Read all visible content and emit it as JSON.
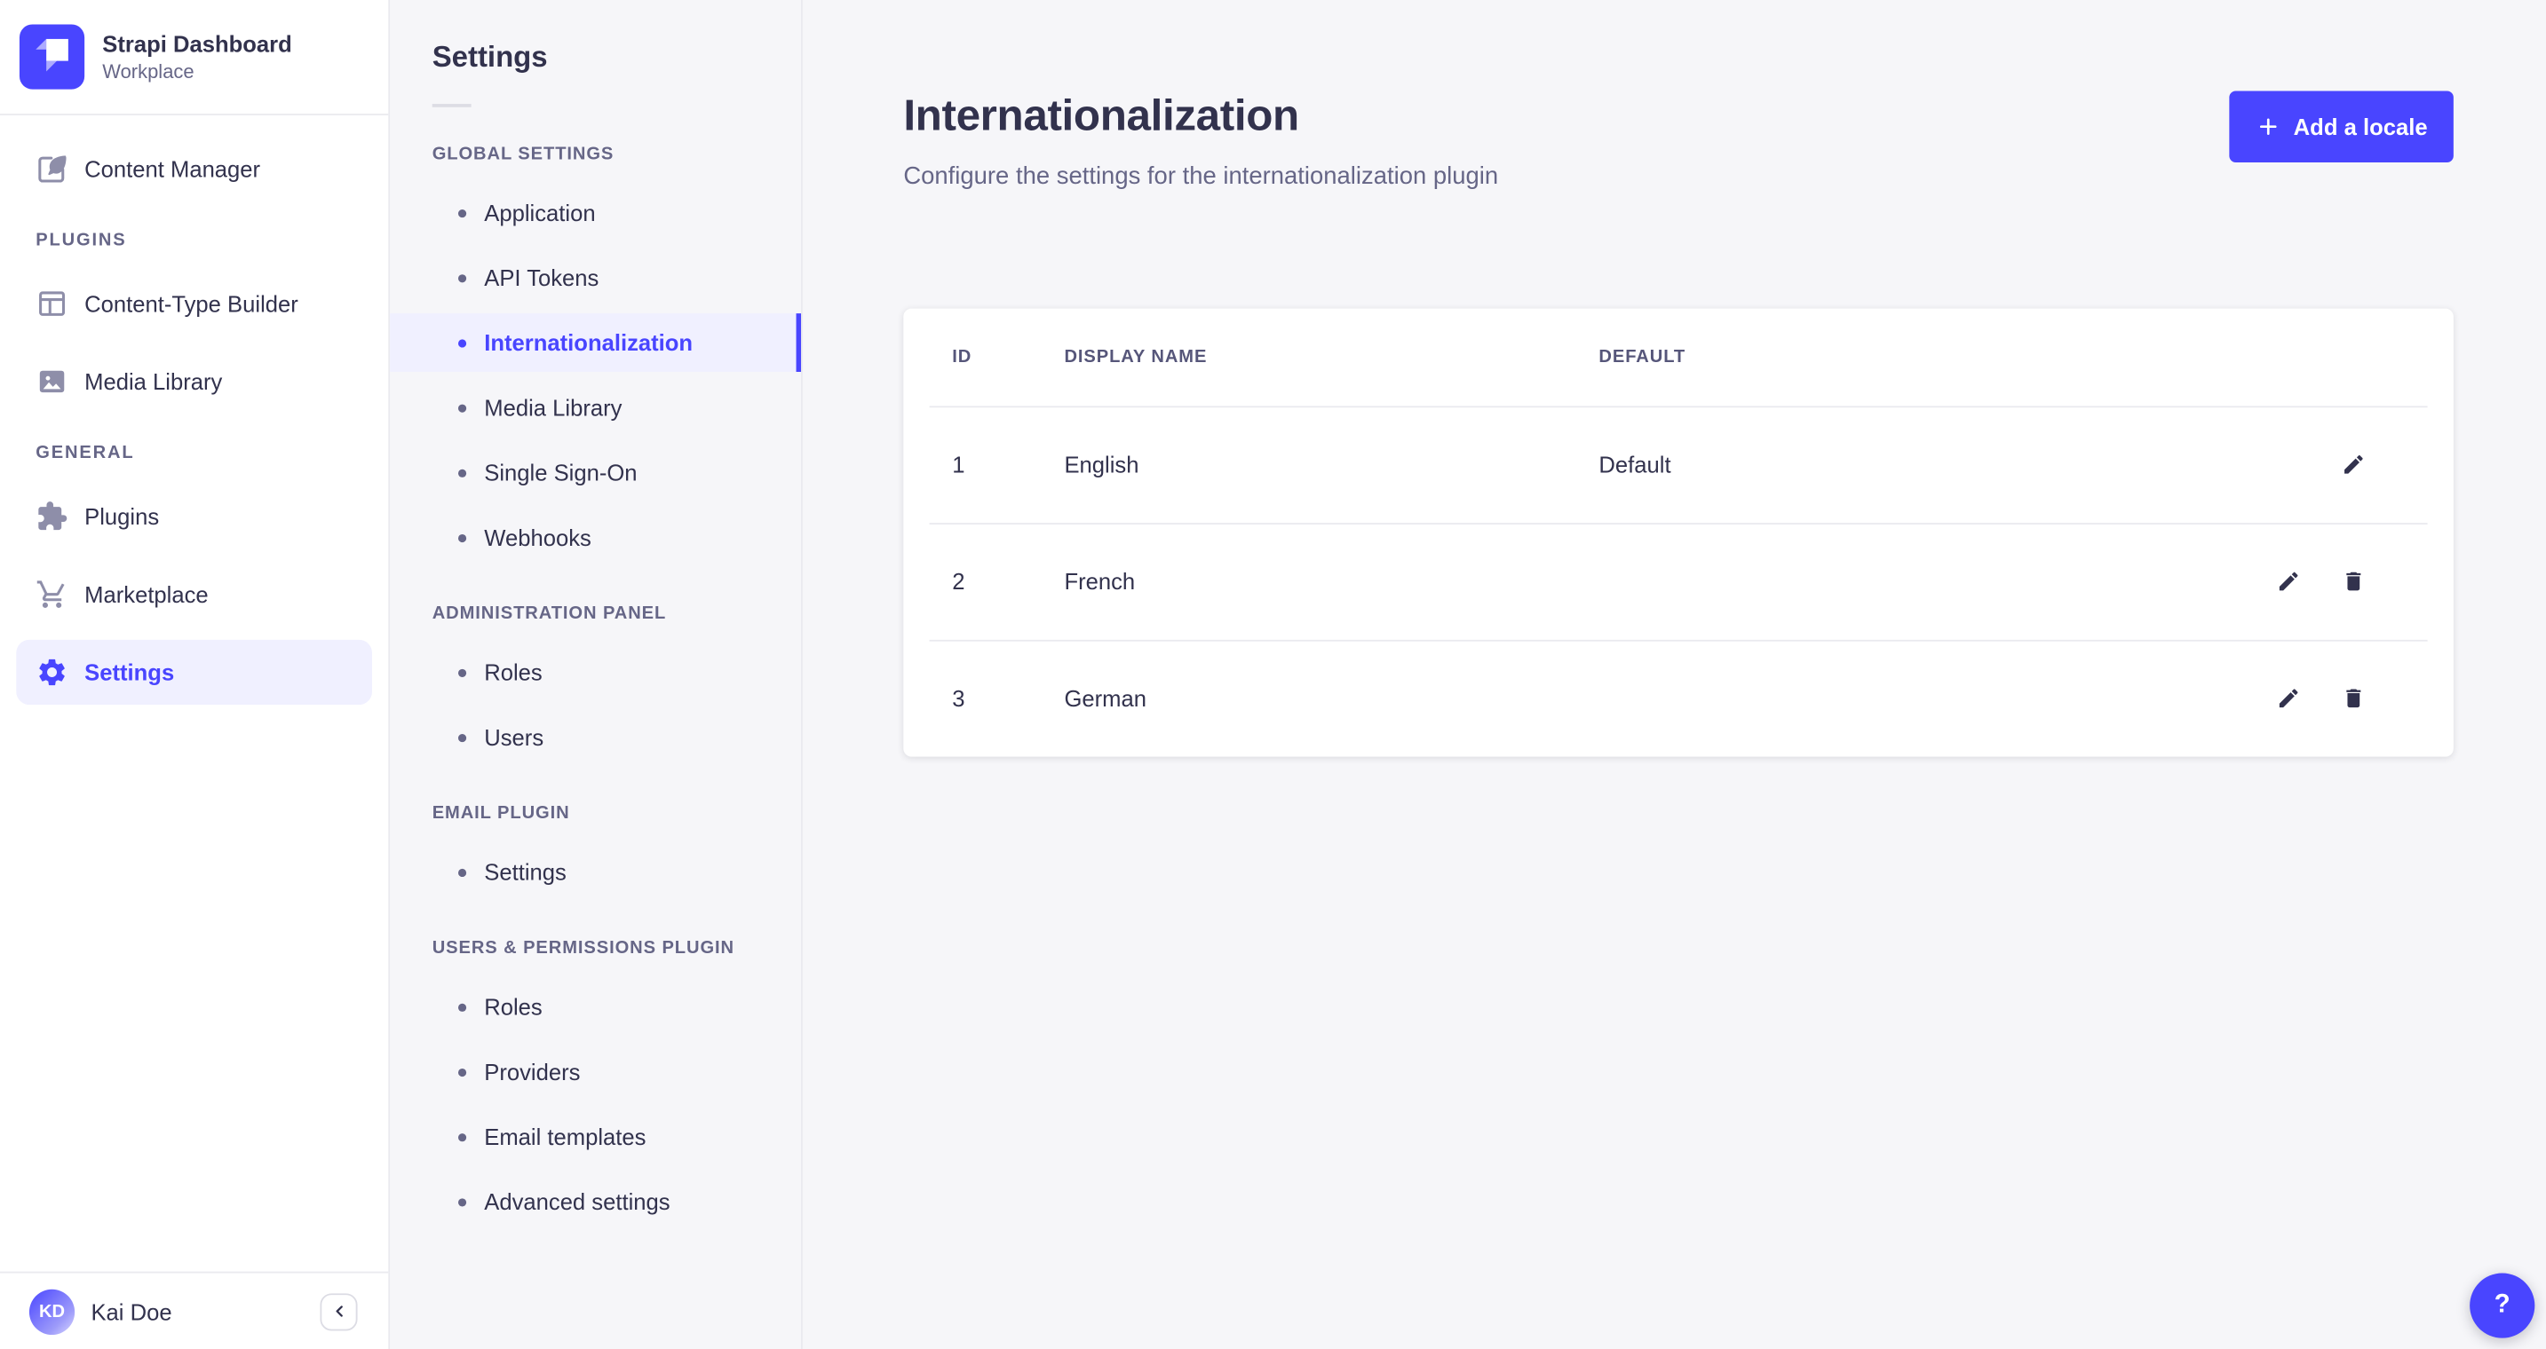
{
  "colors": {
    "primary": "#4945ff",
    "primary_light_bg": "#f0f0ff",
    "text_dark": "#32324d",
    "text_muted": "#666687",
    "icon_muted": "#8e8ea9",
    "border": "#eaeaef",
    "page_bg": "#f6f6f9",
    "card_bg": "#ffffff"
  },
  "sidebar": {
    "brand": {
      "name": "Strapi Dashboard",
      "workspace": "Workplace"
    },
    "content_manager": "Content Manager",
    "sections": [
      {
        "label": "PLUGINS",
        "items": [
          "Content-Type Builder",
          "Media Library"
        ]
      },
      {
        "label": "GENERAL",
        "items": [
          "Plugins",
          "Marketplace",
          "Settings"
        ]
      }
    ],
    "active_item": "Settings",
    "icons": [
      "strapi-logo-icon",
      "content-manager-icon",
      "content-type-builder-icon",
      "media-library-icon",
      "plugins-icon",
      "marketplace-icon",
      "settings-gear-icon",
      "collapse-chevron-left-icon"
    ],
    "user": {
      "initials": "KD",
      "name": "Kai Doe"
    }
  },
  "subnav": {
    "title": "Settings",
    "active_item": "Internationalization",
    "sections": [
      {
        "label": "GLOBAL SETTINGS",
        "items": [
          "Application",
          "API Tokens",
          "Internationalization",
          "Media Library",
          "Single Sign-On",
          "Webhooks"
        ]
      },
      {
        "label": "ADMINISTRATION PANEL",
        "items": [
          "Roles",
          "Users"
        ]
      },
      {
        "label": "EMAIL PLUGIN",
        "items": [
          "Settings"
        ]
      },
      {
        "label": "USERS & PERMISSIONS PLUGIN",
        "items": [
          "Roles",
          "Providers",
          "Email templates",
          "Advanced settings"
        ]
      }
    ]
  },
  "main": {
    "title": "Internationalization",
    "subtitle": "Configure the settings for the internationalization plugin",
    "add_button": "Add a locale",
    "table": {
      "columns": [
        "ID",
        "DISPLAY NAME",
        "DEFAULT"
      ],
      "rows": [
        {
          "id": "1",
          "name": "English",
          "default": "Default"
        },
        {
          "id": "2",
          "name": "French",
          "default": ""
        },
        {
          "id": "3",
          "name": "German",
          "default": ""
        }
      ],
      "row_action_icons": [
        "edit-pencil-icon",
        "delete-trash-icon"
      ]
    },
    "help_label": "?"
  }
}
